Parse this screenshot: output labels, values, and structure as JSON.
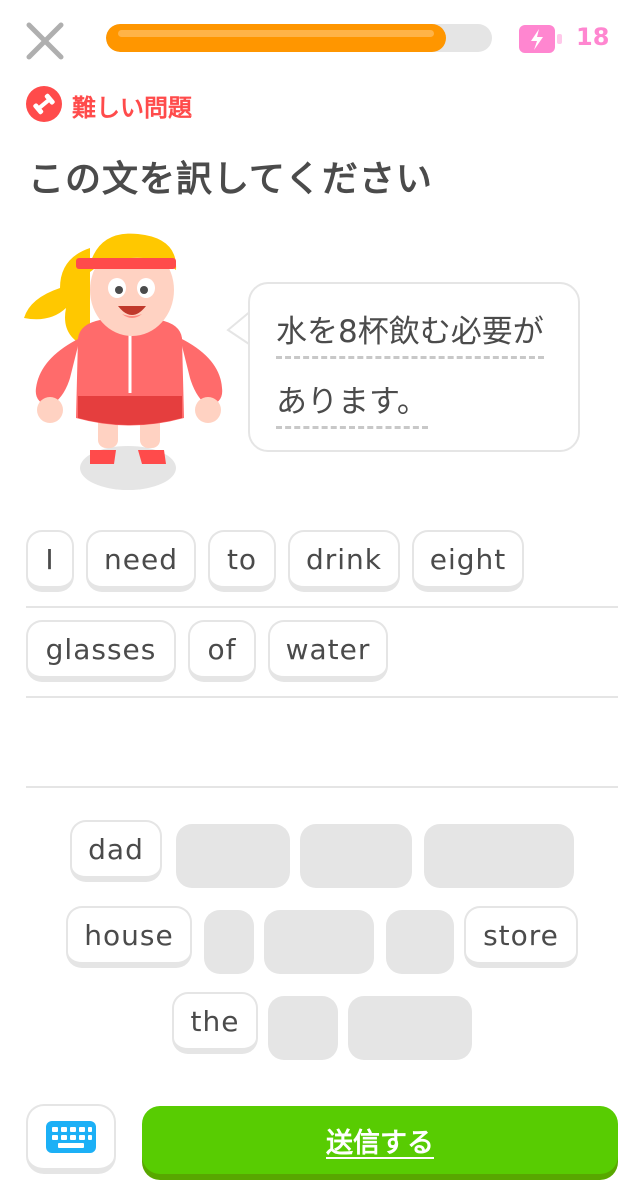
{
  "header": {
    "progress_percent": 88,
    "energy_count": "18",
    "icons": [
      "close-icon",
      "energy-battery-icon"
    ]
  },
  "badge": {
    "label": "難しい問題",
    "icon": "dumbbell-icon"
  },
  "prompt": {
    "title": "この文を訳してください",
    "sentence_line1": "水を8杯飲む必要が",
    "sentence_line2": "あります。"
  },
  "answer": {
    "row1": [
      "I",
      "need",
      "to",
      "drink",
      "eight"
    ],
    "row2": [
      "glasses",
      "of",
      "water"
    ]
  },
  "word_bank": {
    "visible_words": [
      "dad",
      "house",
      "store",
      "the"
    ],
    "used_slot_count": 8
  },
  "bottom": {
    "submit_label": "送信する",
    "keyboard_icon": "keyboard-icon"
  },
  "colors": {
    "progress": "#ff9600",
    "badge": "#ff4b4b",
    "energy": "#ff86d0",
    "submit": "#58cc02",
    "keyboard": "#1cb0f6"
  }
}
